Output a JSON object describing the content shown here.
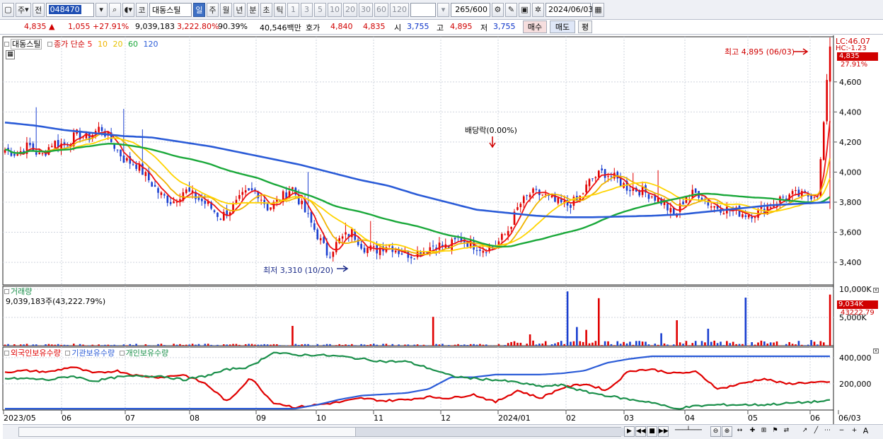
{
  "toolbar": {
    "period_label": "주",
    "prev_label": "전",
    "code": "048470",
    "stock_name": "대동스틸",
    "market_label": "코",
    "period_buttons": [
      "일",
      "주",
      "월",
      "년",
      "분",
      "초",
      "틱"
    ],
    "interval_buttons": [
      "1",
      "3",
      "5",
      "10",
      "20",
      "30",
      "60",
      "120"
    ],
    "count": "265",
    "count_max": "/600",
    "date": "2024/06/03"
  },
  "info": {
    "price": "4,835",
    "change_icon": "up-triangle",
    "change": "1,055",
    "change_pct": "+27.91%",
    "volume": "9,039,183",
    "volume_pct": "3,222.80%",
    "ratio": "90.39%",
    "amount": "40,546백만",
    "quote_label": "호가",
    "ask": "4,840",
    "bid": "4,835",
    "open_label": "시",
    "open": "3,755",
    "high_label": "고",
    "high": "4,895",
    "low_label": "저",
    "low": "3,755",
    "buy_label": "매수",
    "sell_label": "매도",
    "avg_label": "평"
  },
  "legend": {
    "name": "대동스틸",
    "close_label": "종가 단순",
    "ma": [
      "5",
      "10",
      "20",
      "60",
      "120"
    ],
    "ma_colors": [
      "#e11",
      "#f0b400",
      "#ffd400",
      "#1aa83a",
      "#2a5bd7"
    ]
  },
  "right_labels": {
    "lc": "LC:46.07",
    "hc": "HC:-1.23",
    "price_box": "4,835",
    "pct": "27.91%"
  },
  "annotations": {
    "high": "최고 4,895 (06/03)",
    "low": "최저 3,310 (10/20)",
    "dividend": "배당락(0.00%)"
  },
  "volume_panel": {
    "title": "거래량",
    "value": "9,039,183주(43,222.79%)",
    "box": "9,034K",
    "pct": "43222.79"
  },
  "holdings_panel": {
    "series_labels": [
      "외국인보유수량",
      "기관보유수량",
      "개인보유수량"
    ],
    "series_colors": [
      "#e00000",
      "#2a5bd7",
      "#1a8f4a"
    ]
  },
  "controls": {
    "reset": "A"
  },
  "chart_data": [
    {
      "type": "candlestick",
      "title": "대동스틸",
      "y_ticks": [
        "4,600",
        "4,400",
        "4,200",
        "4,000",
        "3,800",
        "3,600",
        "3,400"
      ],
      "ylim": [
        3250,
        4900
      ],
      "x_ticks": [
        "2023/05",
        "06",
        "07",
        "08",
        "09",
        "10",
        "11",
        "12",
        "2024/01",
        "02",
        "03",
        "04",
        "05",
        "06",
        "06/03"
      ],
      "close_path": [
        4150,
        4120,
        4180,
        4100,
        4200,
        4180,
        4250,
        4230,
        4300,
        4190,
        4080,
        4050,
        3950,
        3850,
        3800,
        3880,
        3830,
        3780,
        3700,
        3760,
        3850,
        3880,
        3760,
        3820,
        3900,
        3750,
        3600,
        3450,
        3550,
        3600,
        3500,
        3480,
        3520,
        3470,
        3450,
        3480,
        3520,
        3500,
        3560,
        3520,
        3490,
        3510,
        3600,
        3780,
        3860,
        3850,
        3800,
        3780,
        3820,
        3950,
        4000,
        3960,
        3900,
        3880,
        3850,
        3800,
        3700,
        3850,
        3860,
        3780,
        3760,
        3740,
        3720,
        3730,
        3780,
        3830,
        3850,
        3840,
        3860,
        4835
      ],
      "series": [
        {
          "name": "5"
        },
        {
          "name": "10"
        },
        {
          "name": "20"
        },
        {
          "name": "60"
        },
        {
          "name": "120"
        }
      ],
      "ma120_path": [
        4330,
        4310,
        4280,
        4260,
        4240,
        4230,
        4200,
        4170,
        4130,
        4090,
        4050,
        4000,
        3950,
        3910,
        3850,
        3800,
        3750,
        3730,
        3710,
        3700,
        3700,
        3705,
        3710,
        3720,
        3740,
        3760,
        3780,
        3790,
        3800
      ]
    },
    {
      "type": "bar",
      "title": "거래량",
      "y_ticks": [
        "10,000K",
        "5,000K"
      ],
      "ylim": [
        0,
        10500000
      ]
    },
    {
      "type": "line",
      "title": "보유수량",
      "y_ticks": [
        "400,000",
        "200,000"
      ],
      "ylim": [
        0,
        480000
      ],
      "series": [
        {
          "name": "외국인보유수량"
        },
        {
          "name": "기관보유수량"
        },
        {
          "name": "개인보유수량"
        }
      ]
    }
  ]
}
